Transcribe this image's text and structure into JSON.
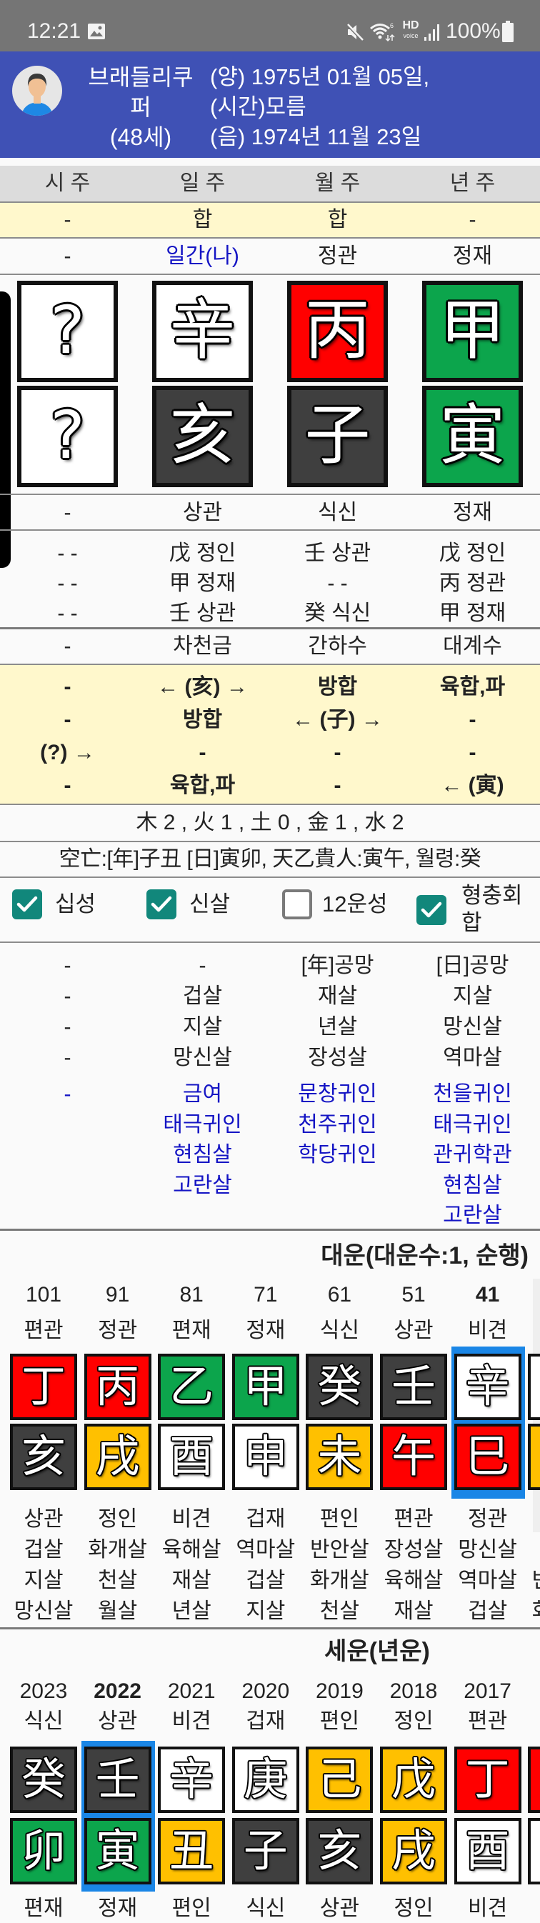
{
  "status_bar": {
    "time": "12:21",
    "battery_text": "100%",
    "hd_label": "HD",
    "voice_label": "voice",
    "icons": [
      "gallery-icon",
      "mute-icon",
      "wifi-icon",
      "hd-voice-icon",
      "signal-icon",
      "battery-icon"
    ]
  },
  "header": {
    "name": "브래들리쿠퍼",
    "age": "(48세)",
    "solar_date": "(양) 1975년 01월 05일,",
    "birth_time": "(시간)모름",
    "lunar_date": "(음) 1974년 11월 23일",
    "avatar_icon": "user-avatar-icon"
  },
  "colors": {
    "header_bg": "#3f51b5",
    "status_bg": "#757575",
    "highlight_row": "#fff8cc",
    "blue_text": "#1414c4",
    "checkbox": "#11877b",
    "current_frame": "#1a86e6",
    "elements": {
      "wood": "#0ca54c",
      "fire": "#ff0000",
      "earth": "#ffc000",
      "metal": "#ffffff",
      "water": "#3f3f3f",
      "unknown": "#ffffff"
    }
  },
  "pillars": {
    "headers": [
      "시 주",
      "일 주",
      "월 주",
      "년 주"
    ],
    "relation_row": [
      "-",
      "합",
      "합",
      "-"
    ],
    "stem_tengods": [
      "-",
      "일간(나)",
      "정관",
      "정재"
    ],
    "day_master_col": 1,
    "stems": [
      {
        "char": "?",
        "element": "unknown"
      },
      {
        "char": "辛",
        "element": "metal"
      },
      {
        "char": "丙",
        "element": "fire"
      },
      {
        "char": "甲",
        "element": "wood"
      }
    ],
    "branches": [
      {
        "char": "?",
        "element": "unknown"
      },
      {
        "char": "亥",
        "element": "water"
      },
      {
        "char": "子",
        "element": "water"
      },
      {
        "char": "寅",
        "element": "wood"
      }
    ],
    "branch_tengods": [
      "-",
      "상관",
      "식신",
      "정재"
    ],
    "hidden_stems": [
      [
        "- -",
        "戊 정인",
        "壬 상관",
        "戊 정인"
      ],
      [
        "- -",
        "甲 정재",
        "- -",
        "丙 정관"
      ],
      [
        "- -",
        "壬 상관",
        "癸 식신",
        "甲 정재"
      ]
    ],
    "nayin": [
      "-",
      "차천금",
      "간하수",
      "대계수"
    ],
    "interactions": [
      [
        "-",
        "← (亥) →",
        "방합",
        "육합,파"
      ],
      [
        "-",
        "방합",
        "← (子) →",
        "-"
      ],
      [
        "(?) →",
        "-",
        "-",
        "-"
      ],
      [
        "-",
        "육합,파",
        "-",
        "← (寅)"
      ]
    ]
  },
  "elements_summary": "木 2 , 火 1 , 土 0 , 金 1 , 水 2",
  "gongmang": "空亡:[年]子丑 [日]寅卯, 天乙貴人:寅午, 월령:癸",
  "options": [
    {
      "label": "십성",
      "checked": true
    },
    {
      "label": "신살",
      "checked": true
    },
    {
      "label": "12운성",
      "checked": false
    },
    {
      "label": "형충회합",
      "checked": true
    }
  ],
  "shinsal": {
    "rows": [
      [
        "-",
        "-",
        "[年]공망",
        "[日]공망"
      ],
      [
        "-",
        "겁살",
        "재살",
        "지살"
      ],
      [
        "-",
        "지살",
        "년살",
        "망신살"
      ],
      [
        "-",
        "망신살",
        "장성살",
        "역마살"
      ]
    ],
    "gwiin_columns": [
      [
        "-"
      ],
      [
        "금여",
        "태극귀인",
        "현침살",
        "고란살"
      ],
      [
        "문창귀인",
        "천주귀인",
        "학당귀인"
      ],
      [
        "천을귀인",
        "태극귀인",
        "관귀학관",
        "현침살",
        "고란살"
      ]
    ]
  },
  "daewoon": {
    "title": "대운(대운수:1, 순행)",
    "current_index": 6,
    "columns": [
      {
        "label": "101",
        "stem_tengod": "편관",
        "stem": "丁",
        "stem_element": "fire",
        "branch": "亥",
        "branch_element": "water",
        "branch_tengod": "상관",
        "shinsal": [
          "겁살",
          "지살",
          "망신살"
        ]
      },
      {
        "label": "91",
        "stem_tengod": "정관",
        "stem": "丙",
        "stem_element": "fire",
        "branch": "戌",
        "branch_element": "earth",
        "branch_tengod": "정인",
        "shinsal": [
          "화개살",
          "천살",
          "월살"
        ]
      },
      {
        "label": "81",
        "stem_tengod": "편재",
        "stem": "乙",
        "stem_element": "wood",
        "branch": "酉",
        "branch_element": "metal",
        "branch_tengod": "비견",
        "shinsal": [
          "육해살",
          "재살",
          "년살"
        ]
      },
      {
        "label": "71",
        "stem_tengod": "정재",
        "stem": "甲",
        "stem_element": "wood",
        "branch": "申",
        "branch_element": "metal",
        "branch_tengod": "겁재",
        "shinsal": [
          "역마살",
          "겁살",
          "지살"
        ]
      },
      {
        "label": "61",
        "stem_tengod": "식신",
        "stem": "癸",
        "stem_element": "water",
        "branch": "未",
        "branch_element": "earth",
        "branch_tengod": "편인",
        "shinsal": [
          "반안살",
          "화개살",
          "천살"
        ]
      },
      {
        "label": "51",
        "stem_tengod": "상관",
        "stem": "壬",
        "stem_element": "water",
        "branch": "午",
        "branch_element": "fire",
        "branch_tengod": "편관",
        "shinsal": [
          "장성살",
          "육해살",
          "재살"
        ]
      },
      {
        "label": "41",
        "stem_tengod": "비견",
        "stem": "辛",
        "stem_element": "metal",
        "branch": "巳",
        "branch_element": "fire",
        "branch_tengod": "정관",
        "shinsal": [
          "망신살",
          "역마살",
          "겁살"
        ]
      },
      {
        "label": "",
        "stem_tengod": "",
        "stem": "",
        "stem_element": "metal",
        "branch": "",
        "branch_element": "earth",
        "branch_tengod": "",
        "shinsal": [
          "",
          "반안살",
          "화개살"
        ]
      }
    ]
  },
  "sewoon": {
    "title": "세운(년운)",
    "current_index": 1,
    "columns": [
      {
        "label": "2023",
        "stem_tengod": "식신",
        "stem": "癸",
        "stem_element": "water",
        "branch": "卯",
        "branch_element": "wood",
        "branch_tengod": "편재"
      },
      {
        "label": "2022",
        "stem_tengod": "상관",
        "stem": "壬",
        "stem_element": "water",
        "branch": "寅",
        "branch_element": "wood",
        "branch_tengod": "정재"
      },
      {
        "label": "2021",
        "stem_tengod": "비견",
        "stem": "辛",
        "stem_element": "metal",
        "branch": "丑",
        "branch_element": "earth",
        "branch_tengod": "편인"
      },
      {
        "label": "2020",
        "stem_tengod": "겁재",
        "stem": "庚",
        "stem_element": "metal",
        "branch": "子",
        "branch_element": "water",
        "branch_tengod": "식신"
      },
      {
        "label": "2019",
        "stem_tengod": "편인",
        "stem": "己",
        "stem_element": "earth",
        "branch": "亥",
        "branch_element": "water",
        "branch_tengod": "상관"
      },
      {
        "label": "2018",
        "stem_tengod": "정인",
        "stem": "戊",
        "stem_element": "earth",
        "branch": "戌",
        "branch_element": "earth",
        "branch_tengod": "정인"
      },
      {
        "label": "2017",
        "stem_tengod": "편관",
        "stem": "丁",
        "stem_element": "fire",
        "branch": "酉",
        "branch_element": "metal",
        "branch_tengod": "비견"
      },
      {
        "label": "",
        "stem_tengod": "",
        "stem": "",
        "stem_element": "fire",
        "branch": "",
        "branch_element": "metal",
        "branch_tengod": ""
      }
    ]
  }
}
